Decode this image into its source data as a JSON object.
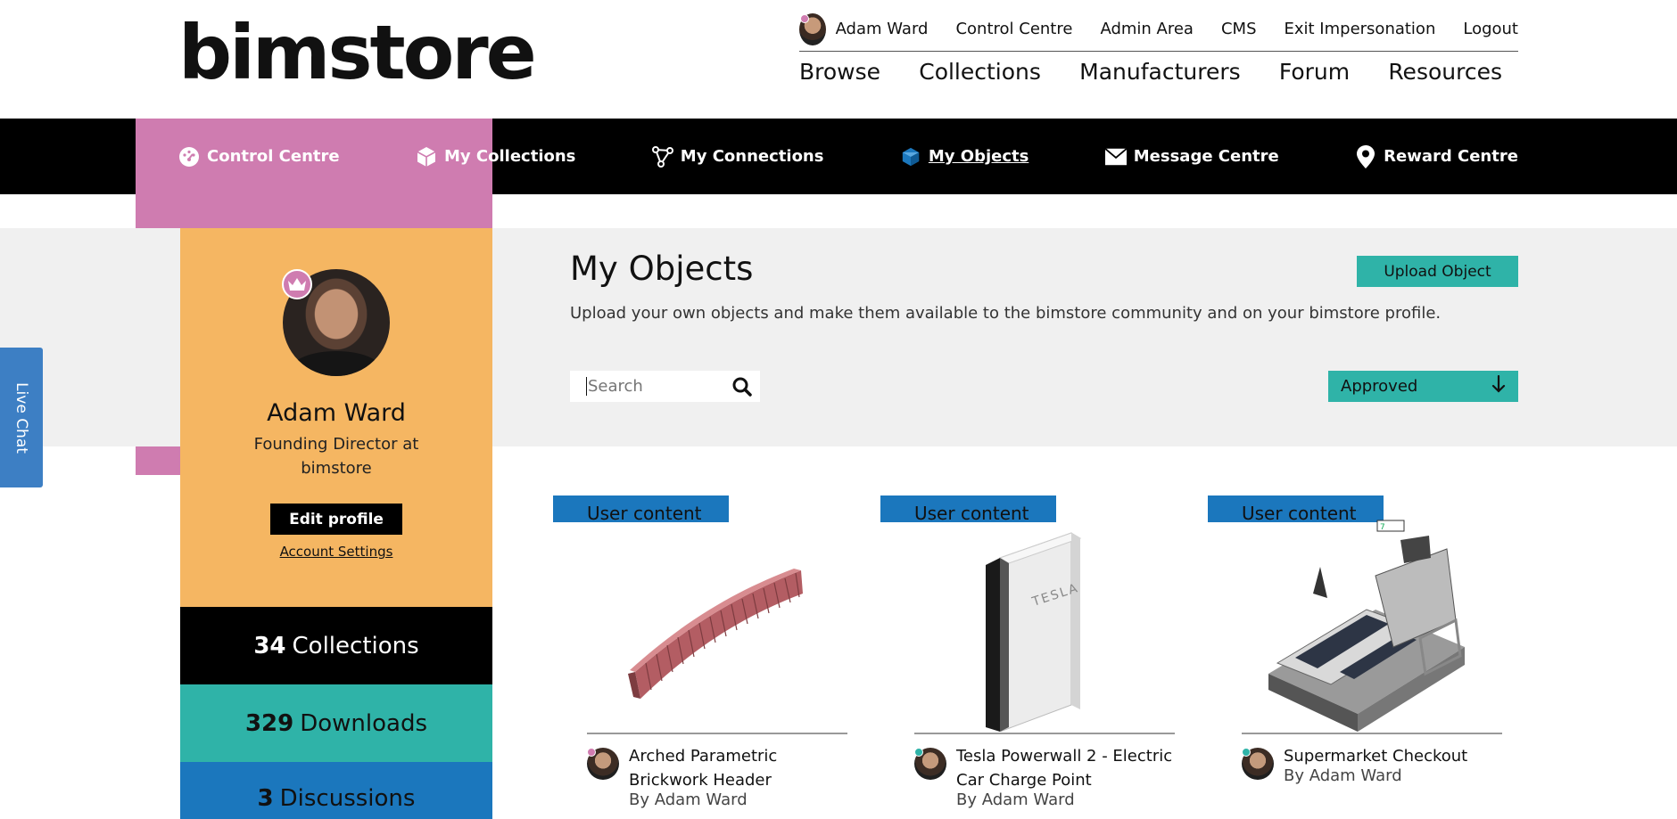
{
  "brand": {
    "logo_text": "bimstore"
  },
  "user_menu": {
    "user_name": "Adam Ward",
    "links": [
      "Control Centre",
      "Admin Area",
      "CMS",
      "Exit Impersonation",
      "Logout"
    ]
  },
  "main_nav": [
    "Browse",
    "Collections",
    "Manufacturers",
    "Forum",
    "Resources"
  ],
  "sub_nav": [
    {
      "label": "Control Centre",
      "icon": "dashboard-icon",
      "active": false
    },
    {
      "label": "My Collections",
      "icon": "cube-icon",
      "active": false
    },
    {
      "label": "My Connections",
      "icon": "connections-icon",
      "active": false
    },
    {
      "label": "My Objects",
      "icon": "object-icon",
      "active": true
    },
    {
      "label": "Message Centre",
      "icon": "envelope-icon",
      "active": false
    },
    {
      "label": "Reward Centre",
      "icon": "location-pin-icon",
      "active": false
    }
  ],
  "live_chat": {
    "label": "Live Chat"
  },
  "profile": {
    "name": "Adam Ward",
    "role": "Founding Director at bimstore",
    "edit_label": "Edit profile",
    "account_label": "Account Settings"
  },
  "stats": {
    "collections": {
      "count": "34",
      "label": "Collections"
    },
    "downloads": {
      "count": "329",
      "label": "Downloads"
    },
    "discussions": {
      "count": "3",
      "label": "Discussions"
    }
  },
  "page": {
    "title": "My Objects",
    "description": "Upload your own objects and make them available to the bimstore community and on your bimstore profile.",
    "upload_label": "Upload Object",
    "search_placeholder": "Search",
    "filter_value": "Approved"
  },
  "objects": [
    {
      "tag": "User content",
      "title": "Arched Parametric Brickwork Header",
      "author": "By Adam Ward"
    },
    {
      "tag": "User content",
      "title": "Tesla Powerwall 2 - Electric Car Charge Point",
      "author": "By Adam Ward"
    },
    {
      "tag": "User content",
      "title": "Supermarket Checkout",
      "author": "By Adam Ward"
    }
  ],
  "colors": {
    "pink": "#cf7cb0",
    "orange": "#f5b662",
    "teal": "#2fb3a8",
    "blue": "#1b77bd",
    "black": "#000000",
    "grey_band": "#f0f0f0"
  }
}
